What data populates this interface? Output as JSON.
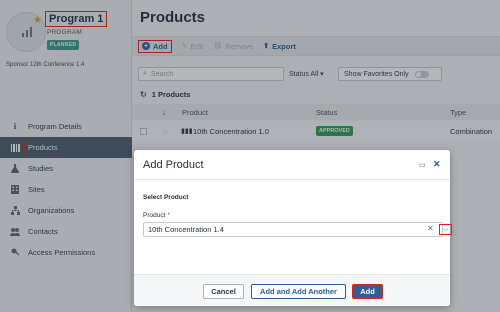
{
  "program": {
    "title": "Program 1",
    "subtitle": "PROGRAM",
    "status_badge": "PLANNED",
    "sponsor": "Sponsor 12th Conference 1.4"
  },
  "sidebar": {
    "items": [
      {
        "label": "Program Details",
        "icon": "info-icon",
        "active": false
      },
      {
        "label": "Products",
        "icon": "barcode-icon",
        "active": true
      },
      {
        "label": "Studies",
        "icon": "flask-icon",
        "active": false
      },
      {
        "label": "Sites",
        "icon": "building-icon",
        "active": false
      },
      {
        "label": "Organizations",
        "icon": "organization-icon",
        "active": false
      },
      {
        "label": "Contacts",
        "icon": "contacts-icon",
        "active": false
      },
      {
        "label": "Access Permissions",
        "icon": "key-icon",
        "active": false
      }
    ]
  },
  "main": {
    "title": "Products",
    "toolbar": {
      "add": "Add",
      "edit": "Edit",
      "remove": "Remove",
      "export": "Export"
    },
    "search_placeholder": "Search",
    "status_filter": "Status All",
    "favorites_filter": "Show Favorites Only",
    "count": "1 Products",
    "columns": {
      "product": "Product",
      "status": "Status",
      "type": "Type"
    },
    "rows": [
      {
        "product": "10th Concentration 1.0",
        "status": "APPROVED",
        "type": "Combination"
      }
    ]
  },
  "modal": {
    "title": "Add Product",
    "section": "Select Product",
    "field_label": "Product",
    "required_mark": "*",
    "selected_value": "10th Concentration 1.4",
    "buttons": {
      "cancel": "Cancel",
      "add_another": "Add and Add Another",
      "add": "Add"
    }
  },
  "colors": {
    "accent": "#2b5c92",
    "sidebar_active": "#4a5a6e",
    "approved": "#2e9a4e",
    "planned": "#3a9b8c",
    "highlight": "#dd2222"
  }
}
